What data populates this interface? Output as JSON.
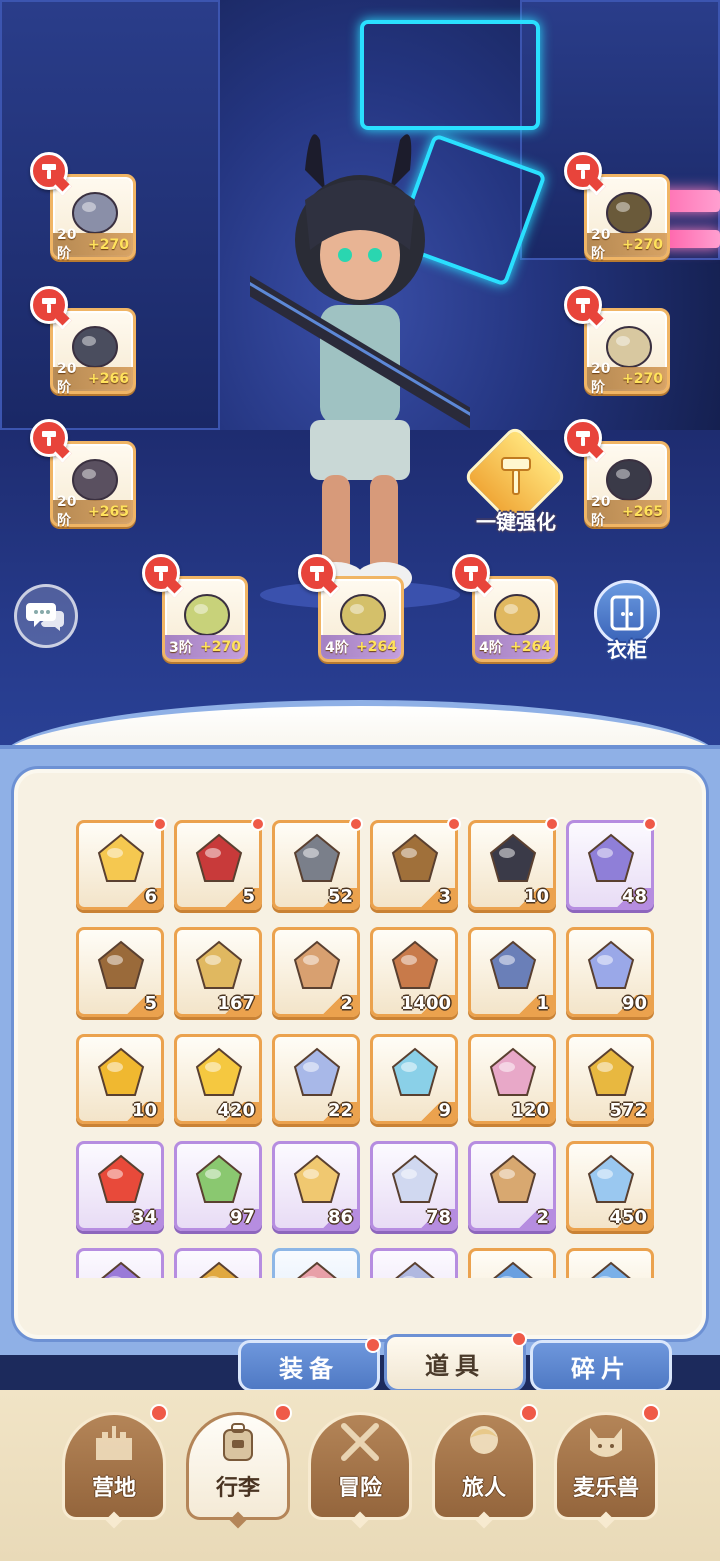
{
  "equipment": [
    {
      "id": "bow",
      "tier": "20阶",
      "bonus": "+270"
    },
    {
      "id": "helmet",
      "tier": "20阶",
      "bonus": "+270"
    },
    {
      "id": "chest",
      "tier": "20阶",
      "bonus": "+266"
    },
    {
      "id": "gloves",
      "tier": "20阶",
      "bonus": "+270"
    },
    {
      "id": "pants",
      "tier": "20阶",
      "bonus": "+265"
    },
    {
      "id": "boots",
      "tier": "20阶",
      "bonus": "+265"
    },
    {
      "id": "ring",
      "tier": "3阶",
      "bonus": "+270"
    },
    {
      "id": "necklace",
      "tier": "4阶",
      "bonus": "+264"
    },
    {
      "id": "earring",
      "tier": "4阶",
      "bonus": "+264"
    }
  ],
  "enhance_all_label": "一键强化",
  "wardrobe_label": "衣柜",
  "inventory": [
    {
      "icon": "star-ticket-icon",
      "count": "6",
      "rarity": "orange",
      "dot": true
    },
    {
      "icon": "red-card-icon",
      "count": "5",
      "rarity": "orange",
      "dot": true
    },
    {
      "icon": "stone-shard-icon",
      "count": "52",
      "rarity": "orange",
      "dot": true
    },
    {
      "icon": "bell-hat-icon",
      "count": "3",
      "rarity": "orange",
      "dot": true
    },
    {
      "icon": "gear-card-icon",
      "count": "10",
      "rarity": "orange",
      "dot": true
    },
    {
      "icon": "moon-ticket-icon",
      "count": "48",
      "rarity": "purple",
      "dot": true
    },
    {
      "icon": "wood-log-icon",
      "count": "5",
      "rarity": "orange",
      "dot": false
    },
    {
      "icon": "spoon-icon",
      "count": "167",
      "rarity": "orange",
      "dot": false
    },
    {
      "icon": "grain-sack-icon",
      "count": "2",
      "rarity": "orange",
      "dot": false
    },
    {
      "icon": "cake-roll-icon",
      "count": "1400",
      "rarity": "orange",
      "dot": false
    },
    {
      "icon": "chest-bundle-icon",
      "count": "1",
      "rarity": "orange",
      "dot": false
    },
    {
      "icon": "paper-plane-icon",
      "count": "90",
      "rarity": "orange",
      "dot": false
    },
    {
      "icon": "gold-gem-icon",
      "count": "10",
      "rarity": "orange",
      "dot": false
    },
    {
      "icon": "gold-star-icon",
      "count": "420",
      "rarity": "orange",
      "dot": false
    },
    {
      "icon": "crystal-orb-icon",
      "count": "22",
      "rarity": "orange",
      "dot": false
    },
    {
      "icon": "ice-crystal-icon",
      "count": "9",
      "rarity": "orange",
      "dot": false
    },
    {
      "icon": "paint-tube-icon",
      "count": "120",
      "rarity": "orange",
      "dot": false
    },
    {
      "icon": "jingle-bell-icon",
      "count": "572",
      "rarity": "orange",
      "dot": false
    },
    {
      "icon": "horseshoe-icon",
      "count": "34",
      "rarity": "purple",
      "dot": false
    },
    {
      "icon": "potion-bottle-icon",
      "count": "97",
      "rarity": "purple",
      "dot": false
    },
    {
      "icon": "paw-pie-icon",
      "count": "86",
      "rarity": "purple",
      "dot": false
    },
    {
      "icon": "cat-spoon-icon",
      "count": "78",
      "rarity": "purple",
      "dot": false
    },
    {
      "icon": "paw-bag-icon",
      "count": "2",
      "rarity": "purple",
      "dot": false
    },
    {
      "icon": "ice-star-icon",
      "count": "450",
      "rarity": "orange",
      "dot": false
    },
    {
      "icon": "purple-gem-icon",
      "count": "",
      "rarity": "purple",
      "dot": false
    },
    {
      "icon": "gold-egg-icon",
      "count": "",
      "rarity": "purple",
      "dot": false
    },
    {
      "icon": "ribbon-icon",
      "count": "",
      "rarity": "blue",
      "dot": false
    },
    {
      "icon": "round-item-icon",
      "count": "",
      "rarity": "purple",
      "dot": false
    },
    {
      "icon": "blue-gem-icon",
      "count": "",
      "rarity": "orange",
      "dot": false
    },
    {
      "icon": "blue-shard-icon",
      "count": "",
      "rarity": "orange",
      "dot": false
    }
  ],
  "tabs": [
    {
      "label": "装备",
      "active": false,
      "dot": true
    },
    {
      "label": "道具",
      "active": true,
      "dot": true
    },
    {
      "label": "碎片",
      "active": false,
      "dot": false
    }
  ],
  "nav": [
    {
      "label": "营地",
      "icon": "castle-icon",
      "active": false,
      "dot": true
    },
    {
      "label": "行李",
      "icon": "backpack-icon",
      "active": true,
      "dot": true
    },
    {
      "label": "冒险",
      "icon": "crossed-swords-icon",
      "active": false,
      "dot": false
    },
    {
      "label": "旅人",
      "icon": "traveler-icon",
      "active": false,
      "dot": true
    },
    {
      "label": "麦乐兽",
      "icon": "cat-pet-icon",
      "active": false,
      "dot": true
    }
  ],
  "colors": {
    "panel_blue": "#8fb0e6",
    "item_orange": "#eba24e",
    "item_purple": "#b68de0",
    "badge_red": "#ef5a48",
    "hammer_red": "#e8443b"
  }
}
